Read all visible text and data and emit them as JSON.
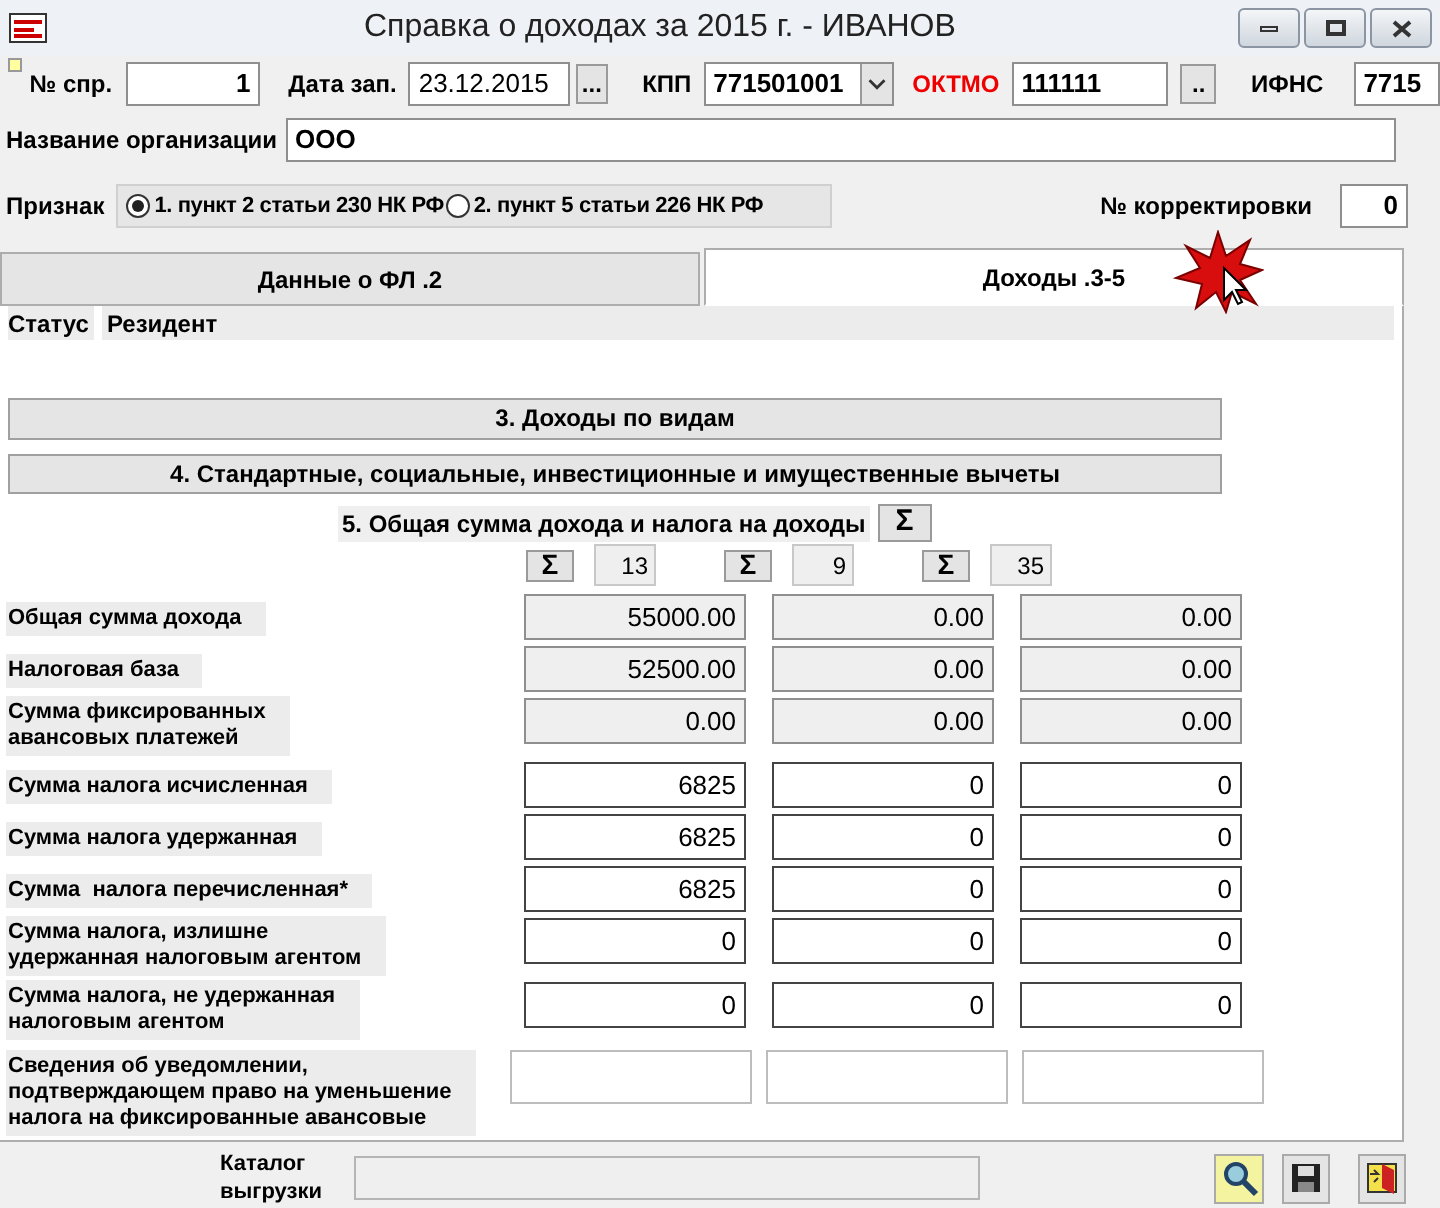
{
  "window": {
    "title": "Справка о доходах за 2015 г. - ИВАНОВ"
  },
  "header": {
    "flag_checked": false,
    "number_label": "№ спр.",
    "number": "1",
    "date_label": "Дата зап.",
    "date": "23.12.2015",
    "date_button": "...",
    "kpp_label": "КПП",
    "kpp": "771501001",
    "oktmo_label": "ОКТМО",
    "oktmo": "111111",
    "oktmo_button": "..",
    "ifns_label": "ИФНС",
    "ifns": "7715"
  },
  "organization": {
    "label": "Название организации",
    "value": "ООО"
  },
  "sign": {
    "label": "Признак",
    "options": [
      {
        "label": "1. пункт 2 статьи 230 НК РФ",
        "selected": true
      },
      {
        "label": "2. пункт 5 статьи 226 НК РФ",
        "selected": false
      }
    ],
    "correction_label": "№ корректировки",
    "correction": "0"
  },
  "tabs": [
    {
      "label": "Данные о ФЛ .2",
      "selected": false
    },
    {
      "label": "Доходы .3-5",
      "selected": true
    }
  ],
  "status": {
    "label": "Статус",
    "value": "Резидент"
  },
  "section_buttons": [
    "3. Доходы по видам",
    "4. Стандартные, социальные, инвестиционные и имущественные вычеты"
  ],
  "section5": {
    "title": "5. Общая сумма дохода и налога на доходы",
    "sum_button": "Σ",
    "rates": [
      {
        "sum_button": "Σ",
        "rate": "13"
      },
      {
        "sum_button": "Σ",
        "rate": "9"
      },
      {
        "sum_button": "Σ",
        "rate": "35"
      }
    ]
  },
  "rows": [
    {
      "kind": "readonly",
      "label": "Общая сумма дохода",
      "values": [
        "55000.00",
        "0.00",
        "0.00"
      ]
    },
    {
      "kind": "readonly",
      "label": "Налоговая база",
      "values": [
        "52500.00",
        "0.00",
        "0.00"
      ]
    },
    {
      "kind": "readonly",
      "label": "Сумма фиксированных\nавансовых платежей",
      "values": [
        "0.00",
        "0.00",
        "0.00"
      ]
    },
    {
      "kind": "input",
      "label": "Сумма налога исчисленная",
      "values": [
        "6825",
        "0",
        "0"
      ]
    },
    {
      "kind": "input",
      "label": "Сумма налога удержанная",
      "values": [
        "6825",
        "0",
        "0"
      ]
    },
    {
      "kind": "input",
      "label": "Сумма  налога перечисленная*",
      "values": [
        "6825",
        "0",
        "0"
      ]
    },
    {
      "kind": "input",
      "label": "Сумма налога, излишне\nудержанная налоговым агентом",
      "values": [
        "0",
        "0",
        "0"
      ]
    },
    {
      "kind": "input",
      "label": "Сумма налога, не удержанная\nналоговым агентом",
      "values": [
        "0",
        "0",
        "0"
      ]
    },
    {
      "kind": "note",
      "label": "Сведения об уведомлении,\nподтверждающем право на уменьшение\nналога на фиксированные авансовые"
    }
  ],
  "catalog": {
    "label": "Каталог\nвыгрузки"
  }
}
